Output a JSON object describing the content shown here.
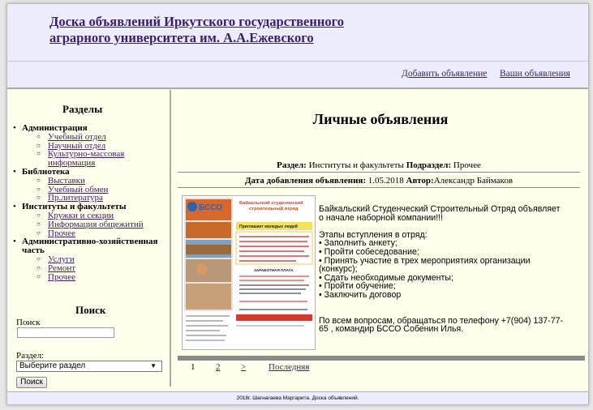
{
  "header": {
    "title_line1": "Доска объявлений Иркутского государственного",
    "title_line2": "аграрного университета им. А.А.Ежевского"
  },
  "topnav": {
    "add_ad": "Добавить объявление",
    "your_ads": "Ваши объявления"
  },
  "sidebar": {
    "sections_title": "Разделы",
    "categories": [
      {
        "label": "Администрация",
        "items": [
          "Учебный отдел",
          "Научный отдел",
          "Культурно-массовая информация"
        ]
      },
      {
        "label": "Библиотека",
        "items": [
          "Выставки",
          "Учебный обмен",
          "Пр.литература"
        ]
      },
      {
        "label": "Институты и факультеты",
        "items": [
          "Кружки и секции",
          "Информация общежитий",
          "Прочее"
        ]
      },
      {
        "label": "Административно-хозяйственная часть",
        "items": [
          "Услуги",
          "Ремонт",
          "Прочее"
        ]
      }
    ],
    "search_title": "Поиск",
    "search_label": "Поиск",
    "search_value": "",
    "section_label": "Раздел:",
    "section_selected": "Выберите раздел",
    "search_button": "Поиск"
  },
  "main": {
    "title": "Личные объявления",
    "section_label": "Раздел:",
    "section_value": "Институты и факультеты",
    "subsection_label": "Подраздел:",
    "subsection_value": "Прочее",
    "date_label": "Дата добавления объявления:",
    "date_value": "1.05.2018",
    "author_label": "Автор:",
    "author_value": "Александр Баймаков",
    "ad_lines": [
      "Байкальский Студенческий Строительный Отряд объявляет",
      "о начале наборной компании!!!",
      "",
      "Этапы вступления в отряд:",
      "• Заполнить анкету;",
      "• Пройти собеседование;",
      "• Принять участие в трех мероприятиях организации",
      "(конкурс);",
      "• Сдать необходимые документы;",
      "• Пройти обучение;",
      "• Заключить договор",
      "",
      "",
      "По всем вопросам, обращаться по телефону +7(904) 137-77-",
      "65 , командир БССО Собенин Илья."
    ],
    "poster": {
      "logo": "БССО",
      "heading": "Байкальский студенческий строительный отряд",
      "invite": "Приглашает молодых людей",
      "salary": "ЗАРАБОТНАЯ ПЛАТА"
    }
  },
  "pagination": {
    "pages": [
      "1",
      "2"
    ],
    "next": ">",
    "last": "Последняя"
  },
  "footer": {
    "text": "2018г. Шагнагаева Маргарита. Доска объявлений."
  },
  "colors": {
    "header_bg": "#ececfc",
    "content_bg": "#ffffec",
    "link": "#3b1d6e",
    "divider": "#8a8a8a"
  }
}
